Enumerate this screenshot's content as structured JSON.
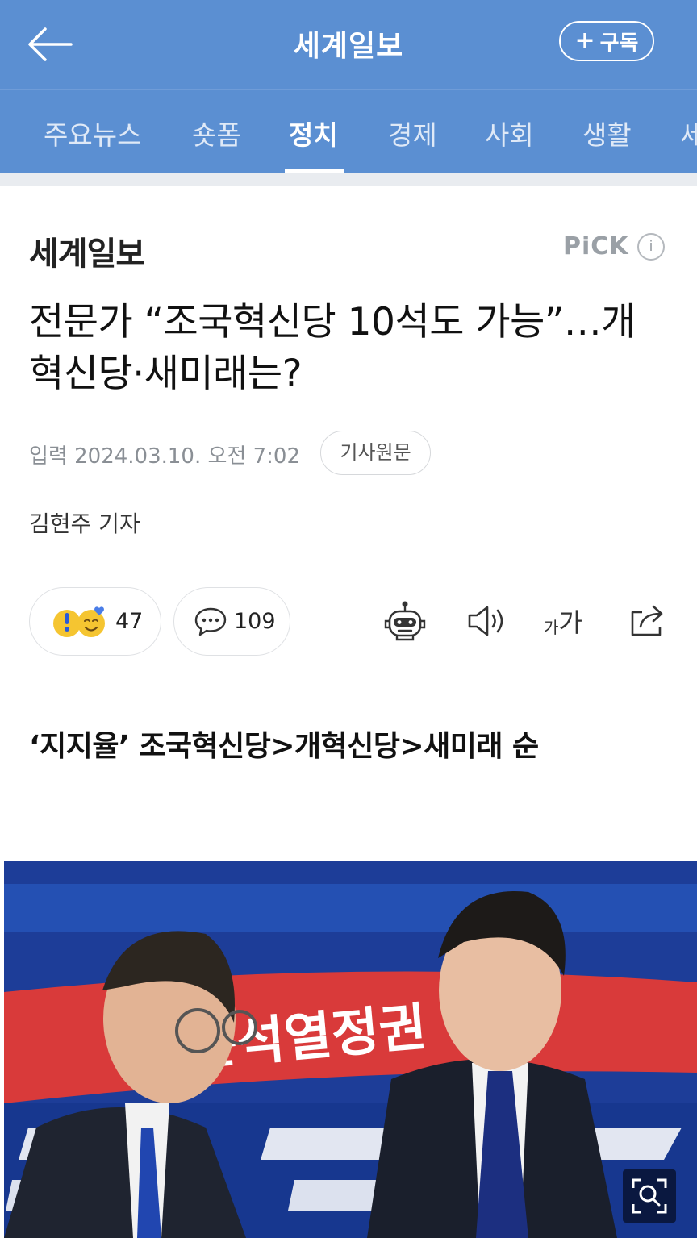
{
  "header": {
    "title": "세계일보",
    "subscribe_label": "구독",
    "subscribe_icon": "plus-icon"
  },
  "nav": {
    "tabs": [
      "주요뉴스",
      "숏폼",
      "정치",
      "경제",
      "사회",
      "생활",
      "세"
    ],
    "active_tab": "정치"
  },
  "article": {
    "brand": "세계일보",
    "pick_label": "PiCK",
    "info_label": "i",
    "headline": "전문가 “조국혁신당 10석도 가능”…개혁신당·새미래는?",
    "date": "입력 2024.03.10. 오전 7:02",
    "original_button": "기사원문",
    "reporter": "김현주 기자",
    "reactions": {
      "count": "47"
    },
    "comments": {
      "count": "109"
    },
    "font_size_label_small": "가",
    "font_size_label_large": "가",
    "subheading": "‘지지율’ 조국혁신당>개혁신당>새미래 순",
    "photo_banner_text": "윤석열정권 심판"
  },
  "colors": {
    "header_bg": "#5b8fd2",
    "photo_bg": "#1d3d98",
    "banner_red": "#d93a3a"
  }
}
